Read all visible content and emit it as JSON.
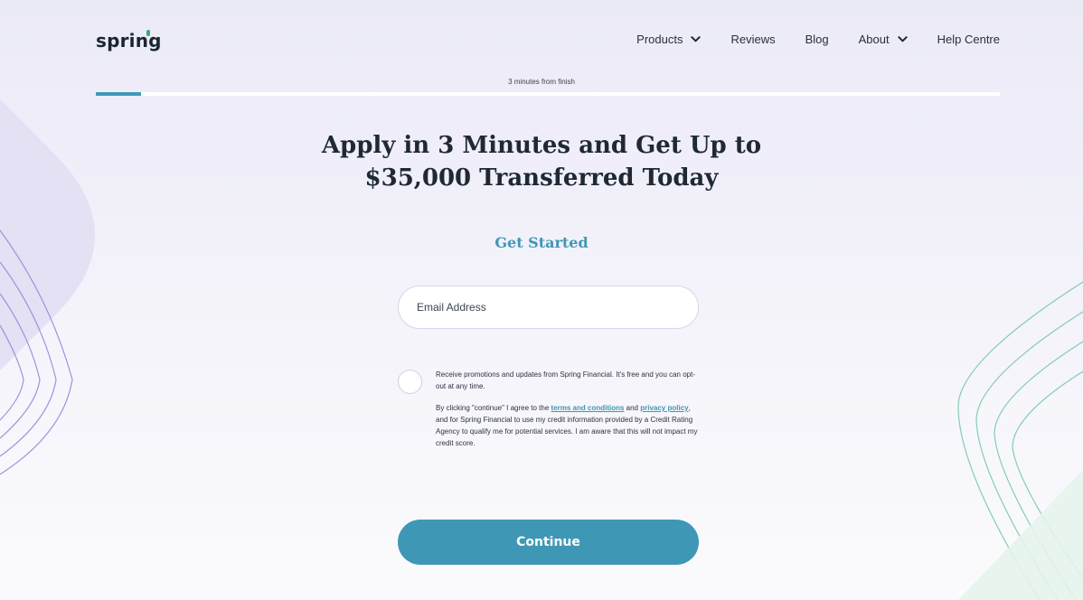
{
  "brand": {
    "logo_text": "spring",
    "accent_color": "#3f97b6",
    "logo_dot_color": "#3aa876"
  },
  "nav": {
    "items": [
      {
        "label": "Products",
        "has_dropdown": true,
        "icon": "chevron-down-icon"
      },
      {
        "label": "Reviews",
        "has_dropdown": false
      },
      {
        "label": "Blog",
        "has_dropdown": false
      },
      {
        "label": "About",
        "has_dropdown": true,
        "icon": "chevron-down-icon"
      },
      {
        "label": "Help Centre",
        "has_dropdown": false
      }
    ]
  },
  "progress": {
    "label": "3 minutes from finish",
    "fraction": 0.05
  },
  "main": {
    "headline_line1": "Apply in 3 Minutes and Get Up to",
    "headline_line2": "$35,000 Transferred Today",
    "subheading": "Get Started",
    "email_placeholder": "Email Address",
    "email_value": "",
    "promo_checked": false,
    "promo_text": "Receive promotions and updates from Spring Financial. It's free and you can opt-out at any time.",
    "legal": {
      "part1": "By clicking \"continue\" I agree to the ",
      "terms_link": "terms and conditions",
      "part2": " and ",
      "privacy_link": "privacy policy",
      "part3": ", and for Spring Financial to use my credit information provided by a Credit Rating Agency to qualify me for potential services. I am aware that this will not impact my credit score."
    },
    "continue_label": "Continue"
  }
}
